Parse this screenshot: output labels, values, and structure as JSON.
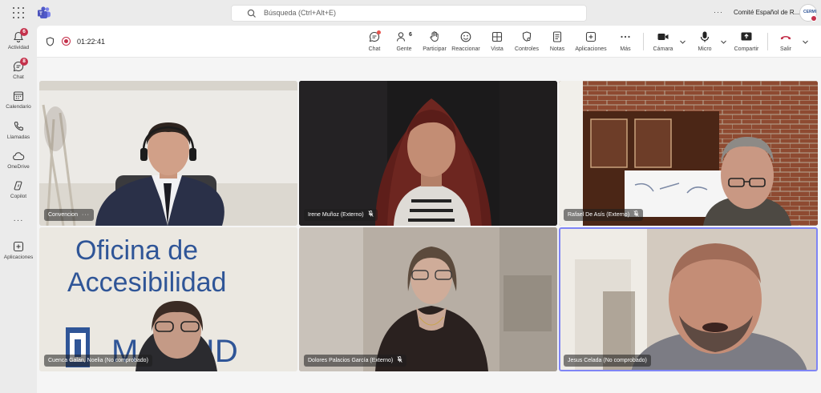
{
  "titlebar": {
    "search_placeholder": "Búsqueda (Ctrl+Alt+E)",
    "more_label": "···",
    "org_name": "Comité Español de R...",
    "org_avatar_text": "CERMI"
  },
  "rail": {
    "items": [
      {
        "label": "Actividad",
        "icon": "bell-icon",
        "badge": "6"
      },
      {
        "label": "Chat",
        "icon": "chat-icon",
        "badge": "8"
      },
      {
        "label": "Calendario",
        "icon": "calendar-icon"
      },
      {
        "label": "Llamadas",
        "icon": "phone-icon"
      },
      {
        "label": "OneDrive",
        "icon": "cloud-icon"
      },
      {
        "label": "Copilot",
        "icon": "copilot-icon"
      },
      {
        "label": "Aplicaciones",
        "icon": "add-apps-icon"
      }
    ],
    "more_label": "···"
  },
  "meeting": {
    "timer": "01:22:41",
    "toolbar": {
      "chat": "Chat",
      "people": "Gente",
      "people_count": "6",
      "raise": "Participar",
      "react": "Reaccionar",
      "view": "Vista",
      "controls": "Controles",
      "notes": "Notas",
      "apps": "Aplicaciones",
      "more": "Más",
      "camera": "Cámara",
      "mic": "Micro",
      "share": "Compartir",
      "leave": "Salir"
    },
    "participants": [
      {
        "name": "Convencion",
        "muted": false,
        "has_more": true
      },
      {
        "name": "Irene Muñoz (Externo)",
        "muted": true
      },
      {
        "name": "Rafael De Asís (Externo)",
        "muted": true
      },
      {
        "name": "Cuenca Galan, Noelia (No comprobado)",
        "muted": false
      },
      {
        "name": "Dolores Palacios García (Externo)",
        "muted": true
      },
      {
        "name": "Jesus Celada (No comprobado)",
        "muted": false,
        "speaking": true
      }
    ],
    "banner": {
      "line1": "Oficina de",
      "line2": "Accesibilidad",
      "line3": "MADRID"
    }
  },
  "colors": {
    "accent": "#5b5fc7",
    "leave": "#c4314b",
    "badge": "#c4314b",
    "speaking_ring": "#7f85f5",
    "banner_text": "#2f5597"
  }
}
